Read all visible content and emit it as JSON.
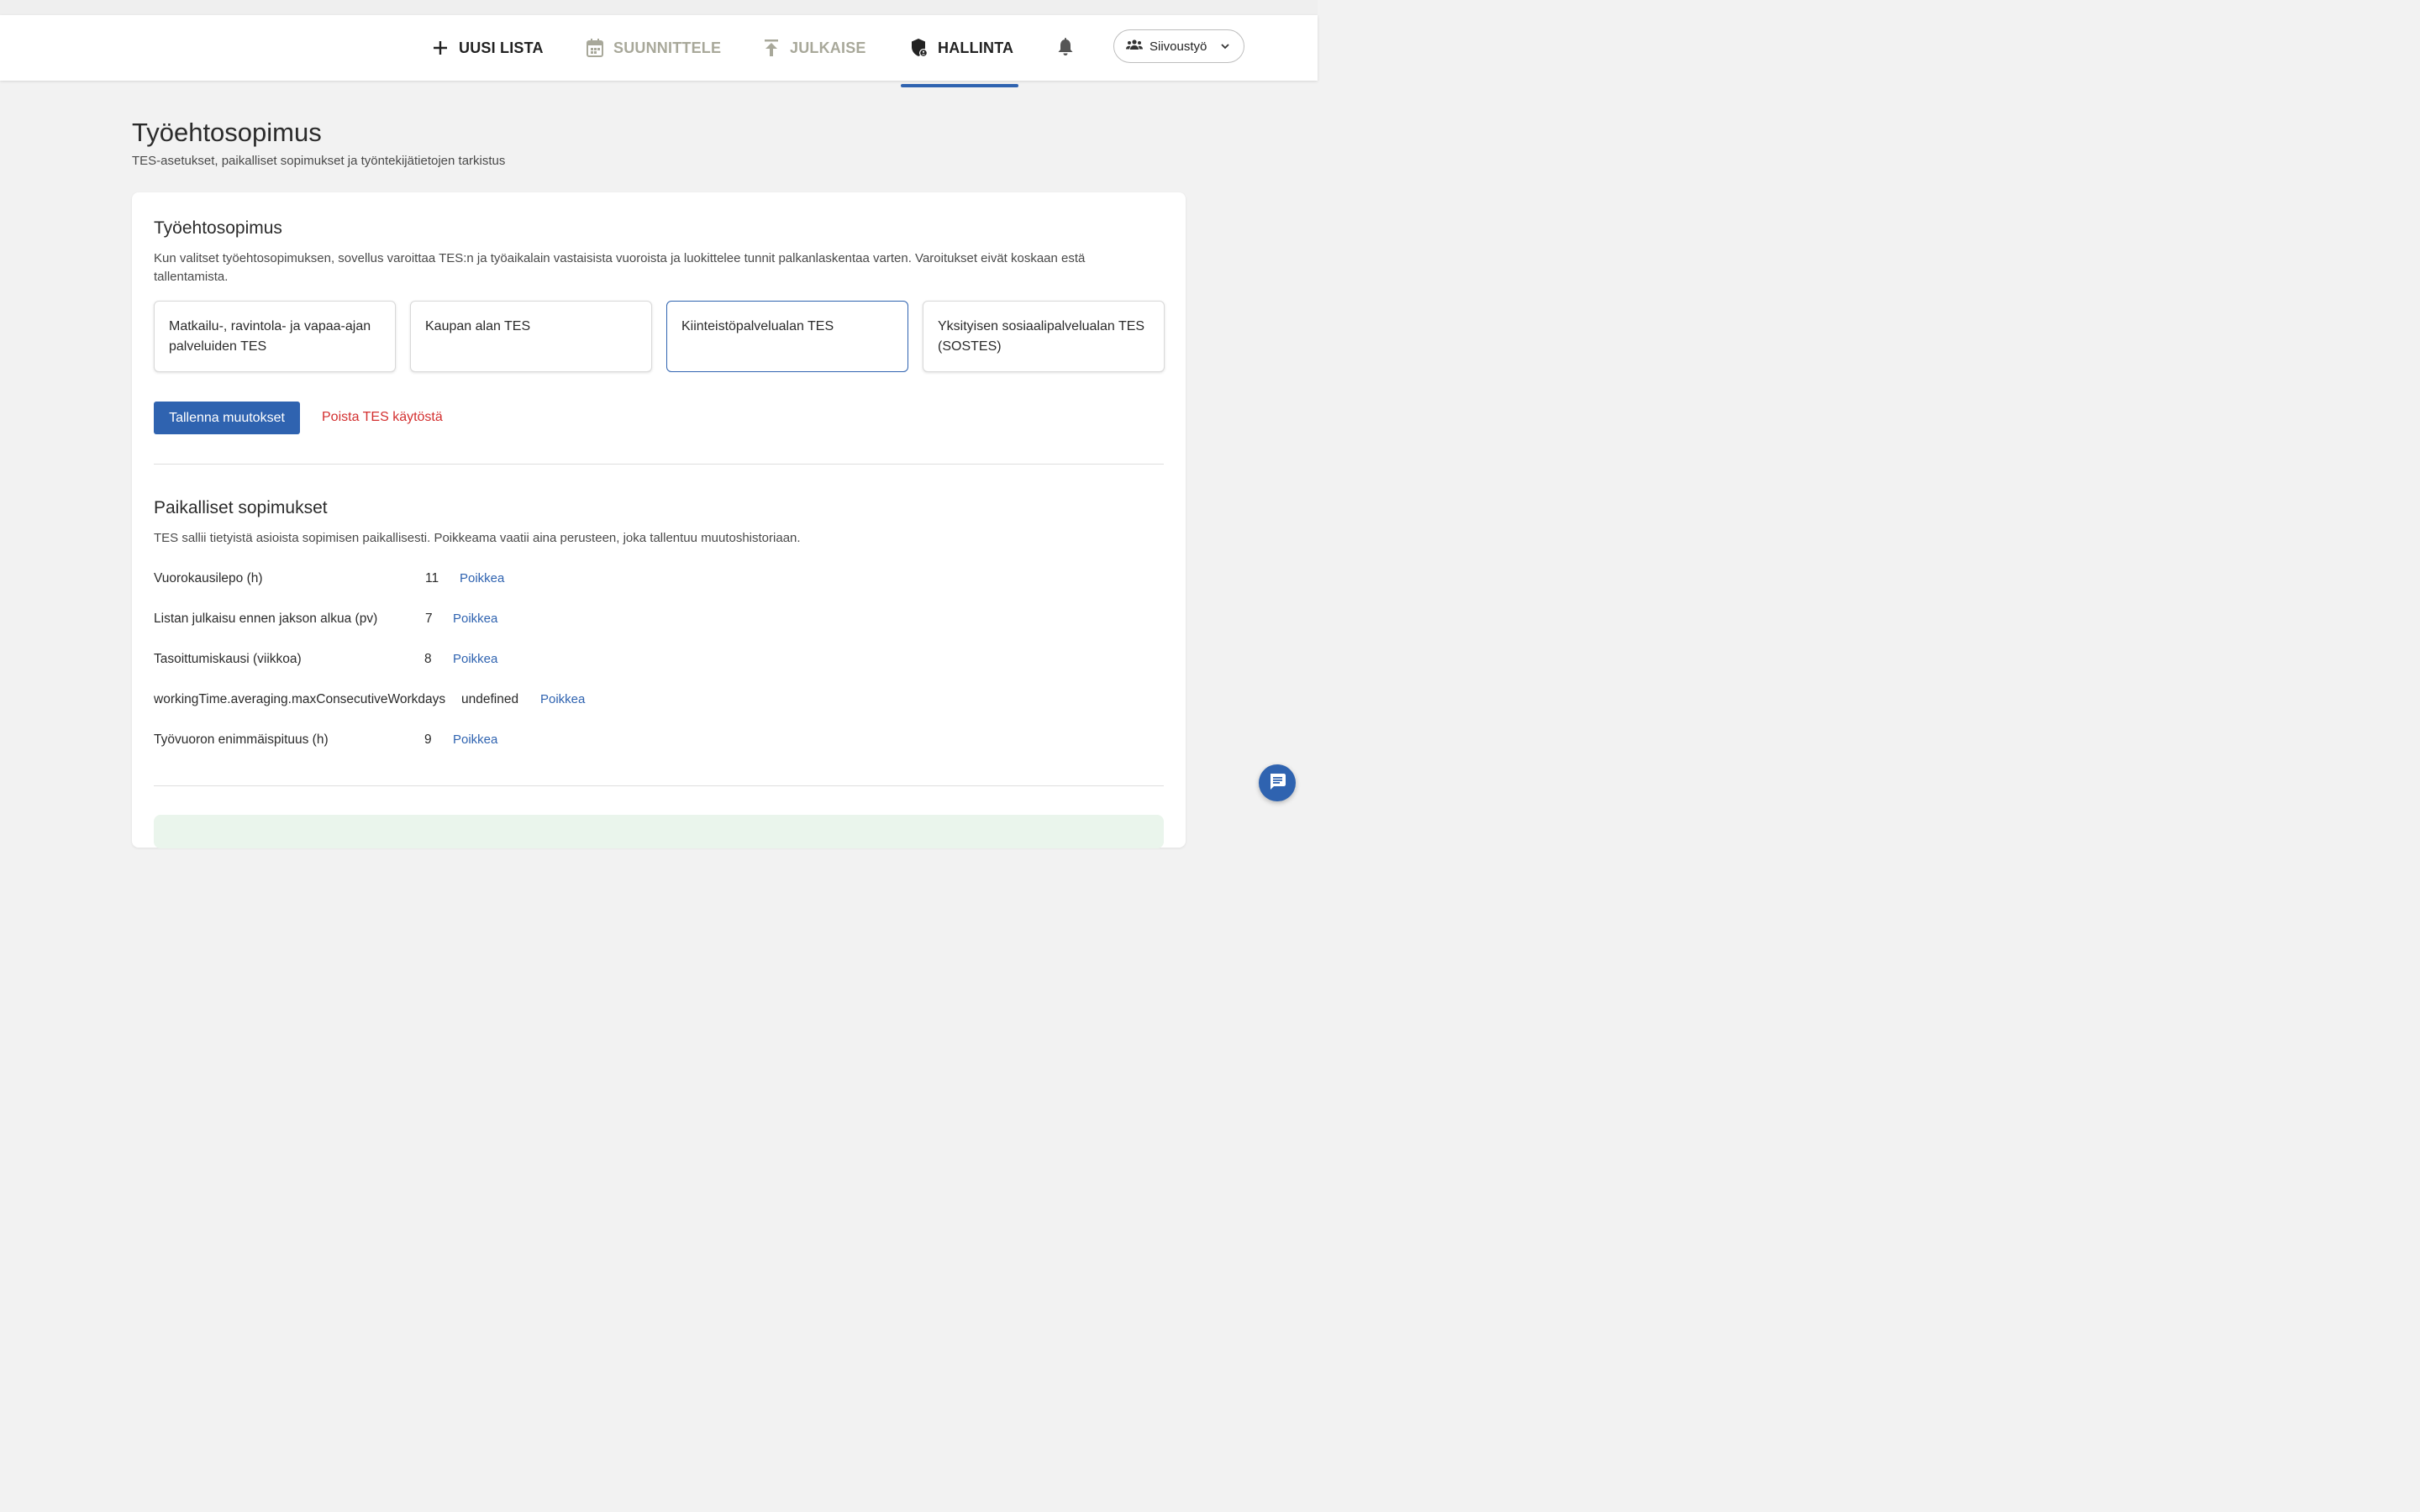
{
  "nav": {
    "new_list": "UUSI LISTA",
    "plan": "SUUNNITTELE",
    "publish": "JULKAISE",
    "admin": "HALLINTA",
    "team": "Siivoustyö"
  },
  "page": {
    "title": "Työehtosopimus",
    "subtitle": "TES-asetukset, paikalliset sopimukset ja työntekijätietojen tarkistus"
  },
  "tes": {
    "title": "Työehtosopimus",
    "description": "Kun valitset työehtosopimuksen, sovellus varoittaa TES:n ja työaikalain vastaisista vuoroista ja luokittelee tunnit palkanlaskentaa varten. Varoitukset eivät koskaan estä tallentamista.",
    "options": [
      {
        "label": "Matkailu-, ravintola- ja vapaa-ajan palveluiden TES",
        "selected": false
      },
      {
        "label": "Kaupan alan TES",
        "selected": false
      },
      {
        "label": "Kiinteistöpalvelualan TES",
        "selected": true
      },
      {
        "label": "Yksityisen sosiaalipalvelualan TES (SOSTES)",
        "selected": false
      }
    ],
    "save_label": "Tallenna muutokset",
    "remove_label": "Poista TES käytöstä"
  },
  "local": {
    "title": "Paikalliset sopimukset",
    "description": "TES sallii tietyistä asioista sopimisen paikallisesti. Poikkeama vaatii aina perusteen, joka tallentuu muutoshistoriaan.",
    "rows": [
      {
        "label": "Vuorokausilepo (h)",
        "value": "11",
        "action": "Poikkea"
      },
      {
        "label": "Listan julkaisu ennen jakson alkua (pv)",
        "value": "7",
        "action": "Poikkea"
      },
      {
        "label": "Tasoittumiskausi (viikkoa)",
        "value": "8",
        "action": "Poikkea"
      },
      {
        "label": "workingTime.averaging.maxConsecutiveWorkdays",
        "value": "undefined",
        "action": "Poikkea"
      },
      {
        "label": "Työvuoron enimmäispituus (h)",
        "value": "9",
        "action": "Poikkea"
      }
    ]
  },
  "colors": {
    "accent": "#2f63b0",
    "danger": "#d32f2f",
    "muted_nav": "#a8a89a"
  }
}
